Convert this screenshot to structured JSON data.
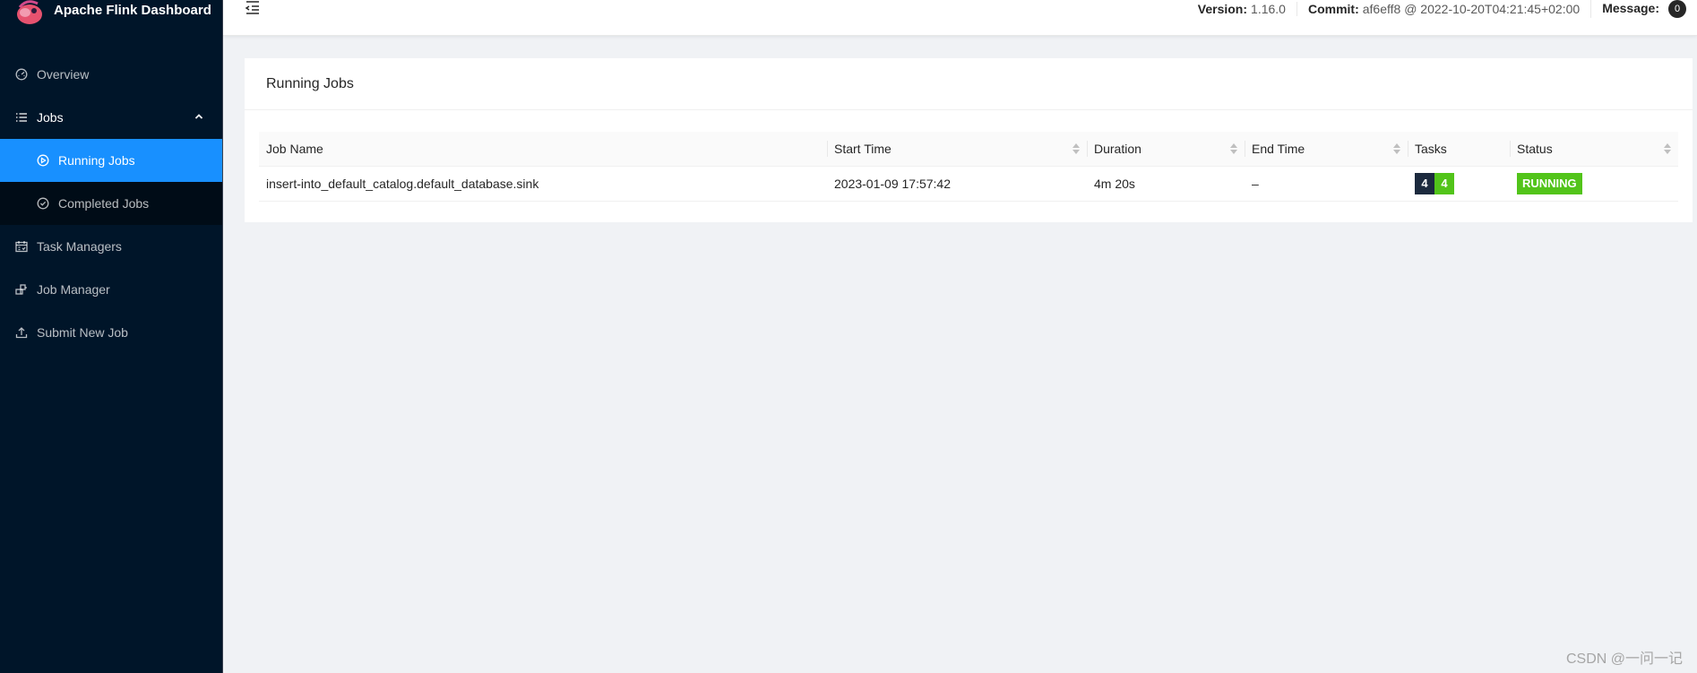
{
  "app": {
    "title": "Apache Flink Dashboard"
  },
  "sidebar": {
    "items": [
      {
        "label": "Overview",
        "icon": "dashboard-icon"
      },
      {
        "label": "Jobs",
        "icon": "list-icon",
        "expanded": true,
        "children": [
          {
            "label": "Running Jobs",
            "icon": "play-circle-icon",
            "active": true
          },
          {
            "label": "Completed Jobs",
            "icon": "check-circle-icon"
          }
        ]
      },
      {
        "label": "Task Managers",
        "icon": "schedule-icon"
      },
      {
        "label": "Job Manager",
        "icon": "build-icon"
      },
      {
        "label": "Submit New Job",
        "icon": "upload-icon"
      }
    ]
  },
  "header": {
    "version_label": "Version:",
    "version_value": "1.16.0",
    "commit_label": "Commit:",
    "commit_value": "af6eff8 @ 2022-10-20T04:21:45+02:00",
    "message_label": "Message:",
    "message_count": "0"
  },
  "page": {
    "title": "Running Jobs",
    "table": {
      "columns": [
        "Job Name",
        "Start Time",
        "Duration",
        "End Time",
        "Tasks",
        "Status"
      ],
      "rows": [
        {
          "job_name": "insert-into_default_catalog.default_database.sink",
          "start_time": "2023-01-09 17:57:42",
          "duration": "4m 20s",
          "end_time": "–",
          "tasks_total": "4",
          "tasks_running": "4",
          "status": "RUNNING"
        }
      ]
    }
  },
  "colors": {
    "sidebar_bg": "#001529",
    "submenu_bg": "#000c17",
    "active_bg": "#1890ff",
    "running_green": "#52c41a",
    "task_total_bg": "#1c2a3e"
  },
  "watermark": "CSDN @一问一记"
}
